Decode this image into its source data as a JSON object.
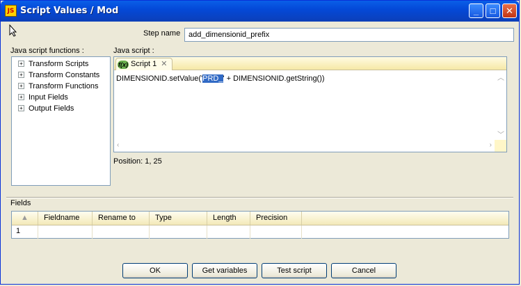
{
  "window": {
    "title": "Script Values / Mod",
    "icon_text": "JS"
  },
  "step_name": {
    "label": "Step name",
    "value": "add_dimensionid_prefix"
  },
  "functions": {
    "label": "Java script functions :",
    "items": [
      "Transform Scripts",
      "Transform Constants",
      "Transform Functions",
      "Input Fields",
      "Output Fields"
    ]
  },
  "editor": {
    "label": "Java script :",
    "tab_label": "Script 1",
    "code_before": "DIMENSIONID.setValue('",
    "code_selected": "PRD_",
    "code_after": "' + DIMENSIONID.getString())",
    "position": "Position: 1, 25"
  },
  "fields": {
    "label": "Fields",
    "columns": [
      "Fieldname",
      "Rename to",
      "Type",
      "Length",
      "Precision"
    ],
    "rows": [
      {
        "num": "1",
        "cells": [
          "",
          "",
          "",
          "",
          ""
        ]
      }
    ]
  },
  "buttons": {
    "ok": "OK",
    "get_variables": "Get variables",
    "test_script": "Test script",
    "cancel": "Cancel"
  }
}
